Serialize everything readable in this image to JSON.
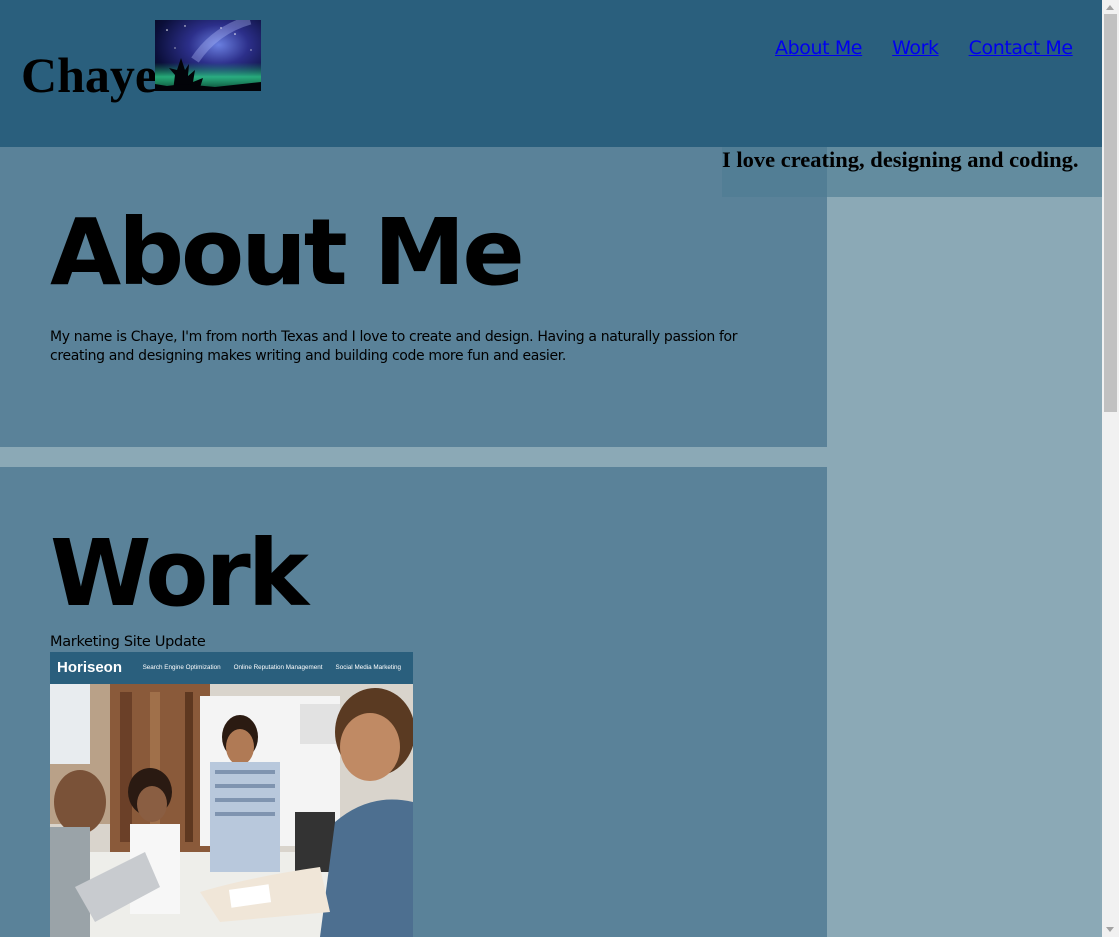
{
  "header": {
    "brand": "Chaye",
    "nav": [
      {
        "label": "About Me"
      },
      {
        "label": "Work"
      },
      {
        "label": "Contact Me"
      }
    ],
    "tagline": "I love creating, designing and coding."
  },
  "about": {
    "title": "About Me",
    "text": "My name is Chaye, I'm from north Texas and I love to create and design. Having a naturally passion for creating and designing makes writing and building code more fun and easier."
  },
  "work": {
    "title": "Work",
    "projects": [
      {
        "caption": "Marketing Site Update",
        "screenshot": {
          "logo": "Horiseon",
          "nav": [
            "Search Engine Optimization",
            "Online Reputation Management",
            "Social Media Marketing"
          ]
        }
      }
    ]
  },
  "colors": {
    "header_bg": "#2a5f7d",
    "section_bg": "#5a8299",
    "page_bg": "#8ba9b6",
    "link": "#0000ee"
  }
}
